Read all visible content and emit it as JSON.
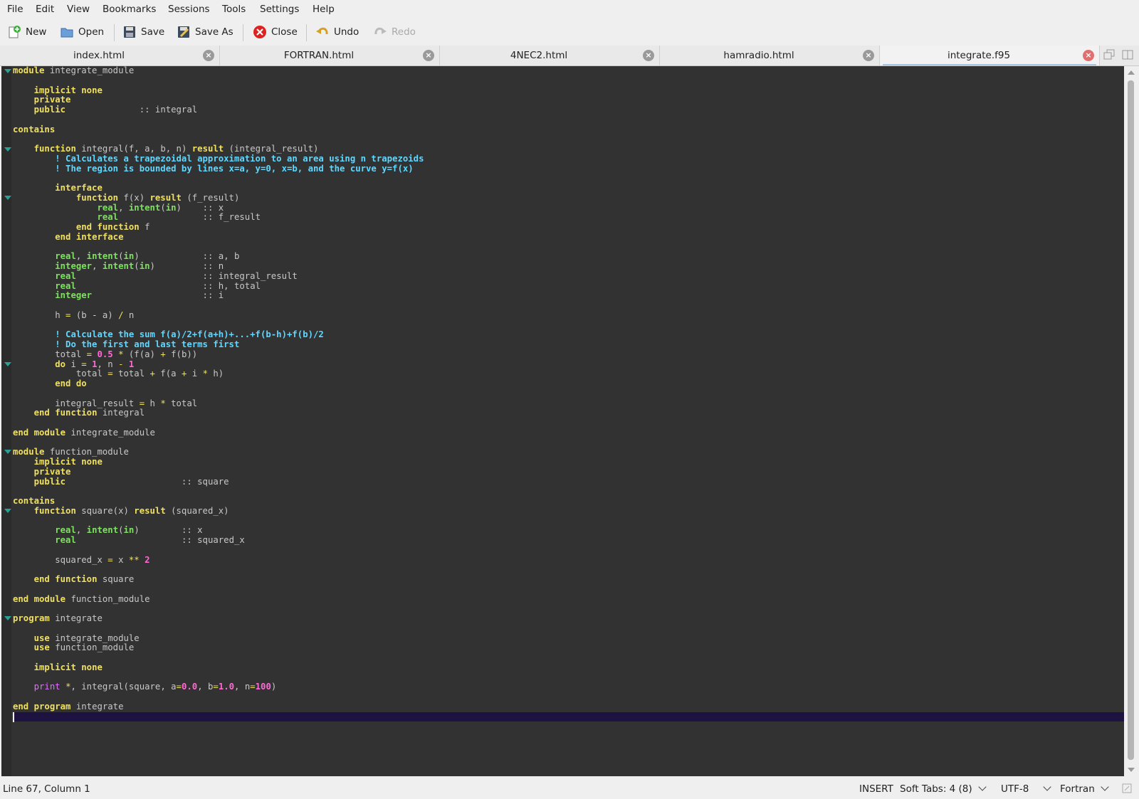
{
  "menu": [
    "File",
    "Edit",
    "View",
    "Bookmarks",
    "Sessions",
    "Tools",
    "Settings",
    "Help"
  ],
  "toolbar": {
    "new": "New",
    "open": "Open",
    "save": "Save",
    "save_as": "Save As",
    "close": "Close",
    "undo": "Undo",
    "redo": "Redo"
  },
  "tabs": [
    {
      "label": "index.html",
      "active": false
    },
    {
      "label": "FORTRAN.html",
      "active": false
    },
    {
      "label": "4NEC2.html",
      "active": false
    },
    {
      "label": "hamradio.html",
      "active": false
    },
    {
      "label": "integrate.f95",
      "active": true
    }
  ],
  "editor": {
    "language": "Fortran",
    "lines": [
      "module integrate_module",
      "",
      "    implicit none",
      "    private",
      "    public              :: integral",
      "",
      "contains",
      "",
      "    function integral(f, a, b, n) result (integral_result)",
      "        ! Calculates a trapezoidal approximation to an area using n trapezoids",
      "        ! The region is bounded by lines x=a, y=0, x=b, and the curve y=f(x)",
      "",
      "        interface",
      "            function f(x) result (f_result)",
      "                real, intent(in)    :: x",
      "                real                :: f_result",
      "            end function f",
      "        end interface",
      "",
      "        real, intent(in)            :: a, b",
      "        integer, intent(in)         :: n",
      "        real                        :: integral_result",
      "        real                        :: h, total",
      "        integer                     :: i",
      "",
      "        h = (b - a) / n",
      "",
      "        ! Calculate the sum f(a)/2+f(a+h)+...+f(b-h)+f(b)/2",
      "        ! Do the first and last terms first",
      "        total = 0.5 * (f(a) + f(b))",
      "        do i = 1, n - 1",
      "            total = total + f(a + i * h)",
      "        end do",
      "",
      "        integral_result = h * total",
      "    end function integral",
      "",
      "end module integrate_module",
      "",
      "module function_module",
      "    implicit none",
      "    private",
      "    public                      :: square",
      "",
      "contains",
      "    function square(x) result (squared_x)",
      "",
      "        real, intent(in)        :: x",
      "        real                    :: squared_x",
      "",
      "        squared_x = x ** 2",
      "",
      "    end function square",
      "",
      "end module function_module",
      "",
      "program integrate",
      "",
      "    use integrate_module",
      "    use function_module",
      "",
      "    implicit none",
      "",
      "    print *, integral(square, a=0.0, b=1.0, n=100)",
      "",
      "end program integrate",
      ""
    ]
  },
  "status": {
    "position": "Line 67, Column 1",
    "mode": "INSERT",
    "tabs": "Soft Tabs: 4 (8)",
    "encoding": "UTF-8",
    "language": "Fortran"
  }
}
